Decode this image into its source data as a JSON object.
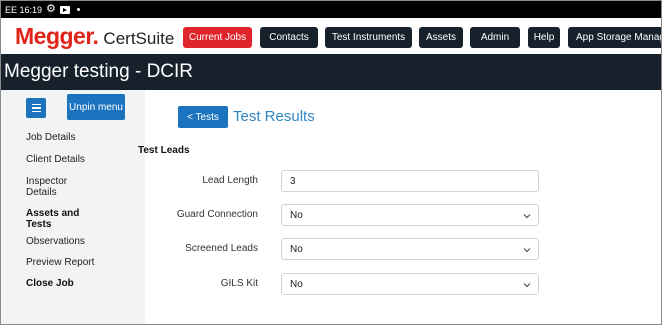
{
  "status_bar": {
    "carrier_time": "EE 16:19",
    "icons": [
      "gear-icon",
      "media-icon",
      "dot-icon"
    ]
  },
  "app": {
    "brand": "Megger.",
    "product": "CertSuite"
  },
  "nav": {
    "items": [
      {
        "label": "Current Jobs",
        "active": true
      },
      {
        "label": "Contacts",
        "active": false
      },
      {
        "label": "Test Instruments",
        "active": false
      },
      {
        "label": "Assets",
        "active": false
      },
      {
        "label": "Admin",
        "active": false
      },
      {
        "label": "Help",
        "active": false
      },
      {
        "label": "App Storage Manag",
        "active": false
      }
    ]
  },
  "page": {
    "title": "Megger testing - DCIR"
  },
  "sidebar": {
    "menu_icon": "hamburger-icon",
    "unpin_label": "Unpin menu",
    "items": [
      {
        "label": "Job Details",
        "bold": false
      },
      {
        "label": "Client Details",
        "bold": false
      },
      {
        "label": "Inspector Details",
        "bold": false
      },
      {
        "label": "Assets and Tests",
        "bold": true
      },
      {
        "label": "Observations",
        "bold": false
      },
      {
        "label": "Preview Report",
        "bold": false
      },
      {
        "label": "Close Job",
        "bold": true
      }
    ]
  },
  "main": {
    "back_button": "< Tests",
    "section_title": "Test Results",
    "group_title": "Test Leads",
    "fields": [
      {
        "label": "Lead Length",
        "value": "3",
        "type": "text"
      },
      {
        "label": "Guard Connection",
        "value": "No",
        "type": "select"
      },
      {
        "label": "Screened Leads",
        "value": "No",
        "type": "select"
      },
      {
        "label": "GILS Kit",
        "value": "No",
        "type": "select"
      }
    ]
  },
  "colors": {
    "brand_red": "#e2231a",
    "nav_active": "#e0242b",
    "nav_dark": "#16212b",
    "button_blue": "#1b74bd",
    "title_blue": "#2f86c6",
    "sidebar_bg": "#f2f3f5"
  }
}
